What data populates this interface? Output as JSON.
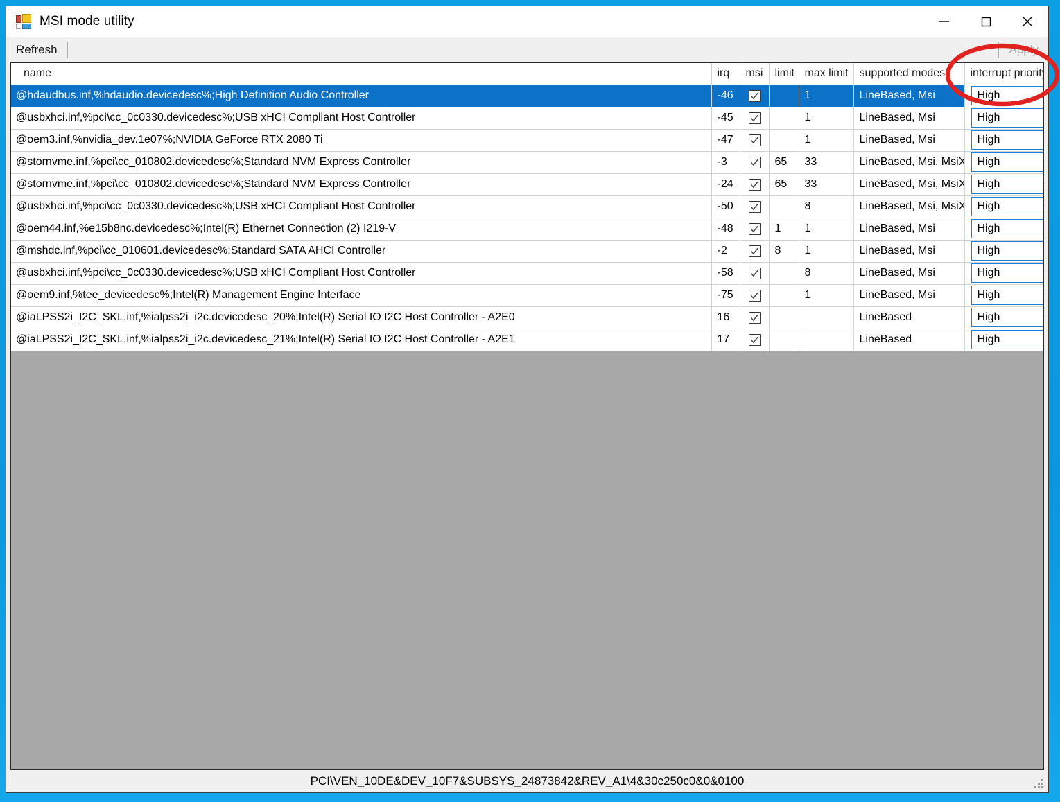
{
  "window": {
    "title": "MSI mode utility",
    "icon": "app-icon",
    "buttons": {
      "minimize": "minimize-icon",
      "maximize": "maximize-icon",
      "close": "close-icon"
    }
  },
  "toolbar": {
    "refresh_label": "Refresh",
    "apply_label": "Apply",
    "apply_disabled": true
  },
  "table": {
    "columns": [
      "name",
      "irq",
      "msi",
      "limit",
      "max limit",
      "supported modes",
      "interrupt priority"
    ],
    "rows": [
      {
        "name": "@hdaudbus.inf,%hdaudio.devicedesc%;High Definition Audio Controller",
        "irq": "-46",
        "msi": true,
        "limit": "",
        "max_limit": "1",
        "supported_modes": "LineBased, Msi",
        "interrupt_priority": "High",
        "selected": true
      },
      {
        "name": "@usbxhci.inf,%pci\\cc_0c0330.devicedesc%;USB xHCI Compliant Host Controller",
        "irq": "-45",
        "msi": true,
        "limit": "",
        "max_limit": "1",
        "supported_modes": "LineBased, Msi",
        "interrupt_priority": "High",
        "selected": false
      },
      {
        "name": "@oem3.inf,%nvidia_dev.1e07%;NVIDIA GeForce RTX 2080 Ti",
        "irq": "-47",
        "msi": true,
        "limit": "",
        "max_limit": "1",
        "supported_modes": "LineBased, Msi",
        "interrupt_priority": "High",
        "selected": false
      },
      {
        "name": "@stornvme.inf,%pci\\cc_010802.devicedesc%;Standard NVM Express Controller",
        "irq": "-3",
        "msi": true,
        "limit": "65",
        "max_limit": "33",
        "supported_modes": "LineBased, Msi, MsiX",
        "interrupt_priority": "High",
        "selected": false
      },
      {
        "name": "@stornvme.inf,%pci\\cc_010802.devicedesc%;Standard NVM Express Controller",
        "irq": "-24",
        "msi": true,
        "limit": "65",
        "max_limit": "33",
        "supported_modes": "LineBased, Msi, MsiX",
        "interrupt_priority": "High",
        "selected": false
      },
      {
        "name": "@usbxhci.inf,%pci\\cc_0c0330.devicedesc%;USB xHCI Compliant Host Controller",
        "irq": "-50",
        "msi": true,
        "limit": "",
        "max_limit": "8",
        "supported_modes": "LineBased, Msi, MsiX",
        "interrupt_priority": "High",
        "selected": false
      },
      {
        "name": "@oem44.inf,%e15b8nc.devicedesc%;Intel(R) Ethernet Connection (2) I219-V",
        "irq": "-48",
        "msi": true,
        "limit": "1",
        "max_limit": "1",
        "supported_modes": "LineBased, Msi",
        "interrupt_priority": "High",
        "selected": false
      },
      {
        "name": "@mshdc.inf,%pci\\cc_010601.devicedesc%;Standard SATA AHCI Controller",
        "irq": "-2",
        "msi": true,
        "limit": "8",
        "max_limit": "1",
        "supported_modes": "LineBased, Msi",
        "interrupt_priority": "High",
        "selected": false
      },
      {
        "name": "@usbxhci.inf,%pci\\cc_0c0330.devicedesc%;USB xHCI Compliant Host Controller",
        "irq": "-58",
        "msi": true,
        "limit": "",
        "max_limit": "8",
        "supported_modes": "LineBased, Msi",
        "interrupt_priority": "High",
        "selected": false
      },
      {
        "name": "@oem9.inf,%tee_devicedesc%;Intel(R) Management Engine Interface",
        "irq": "-75",
        "msi": true,
        "limit": "",
        "max_limit": "1",
        "supported_modes": "LineBased, Msi",
        "interrupt_priority": "High",
        "selected": false
      },
      {
        "name": "@iaLPSS2i_I2C_SKL.inf,%ialpss2i_i2c.devicedesc_20%;Intel(R) Serial IO I2C Host Controller - A2E0",
        "irq": "16",
        "msi": true,
        "limit": "",
        "max_limit": "",
        "supported_modes": "LineBased",
        "interrupt_priority": "High",
        "selected": false
      },
      {
        "name": "@iaLPSS2i_I2C_SKL.inf,%ialpss2i_i2c.devicedesc_21%;Intel(R) Serial IO I2C Host Controller - A2E1",
        "irq": "17",
        "msi": true,
        "limit": "",
        "max_limit": "",
        "supported_modes": "LineBased",
        "interrupt_priority": "High",
        "selected": false
      }
    ]
  },
  "statusbar": {
    "text": "PCI\\VEN_10DE&DEV_10F7&SUBSYS_24873842&REV_A1\\4&30c250c0&0&0100",
    "grip": "resize-grip-icon"
  },
  "annotation": {
    "shape": "ellipse-highlight",
    "color": "#e0231f",
    "target": "interrupt priority"
  },
  "colors": {
    "selection": "#0c72c8",
    "combo_border": "#1f7fd0",
    "desktop": "#0b9ade",
    "empty_area": "#a8a8a8"
  }
}
